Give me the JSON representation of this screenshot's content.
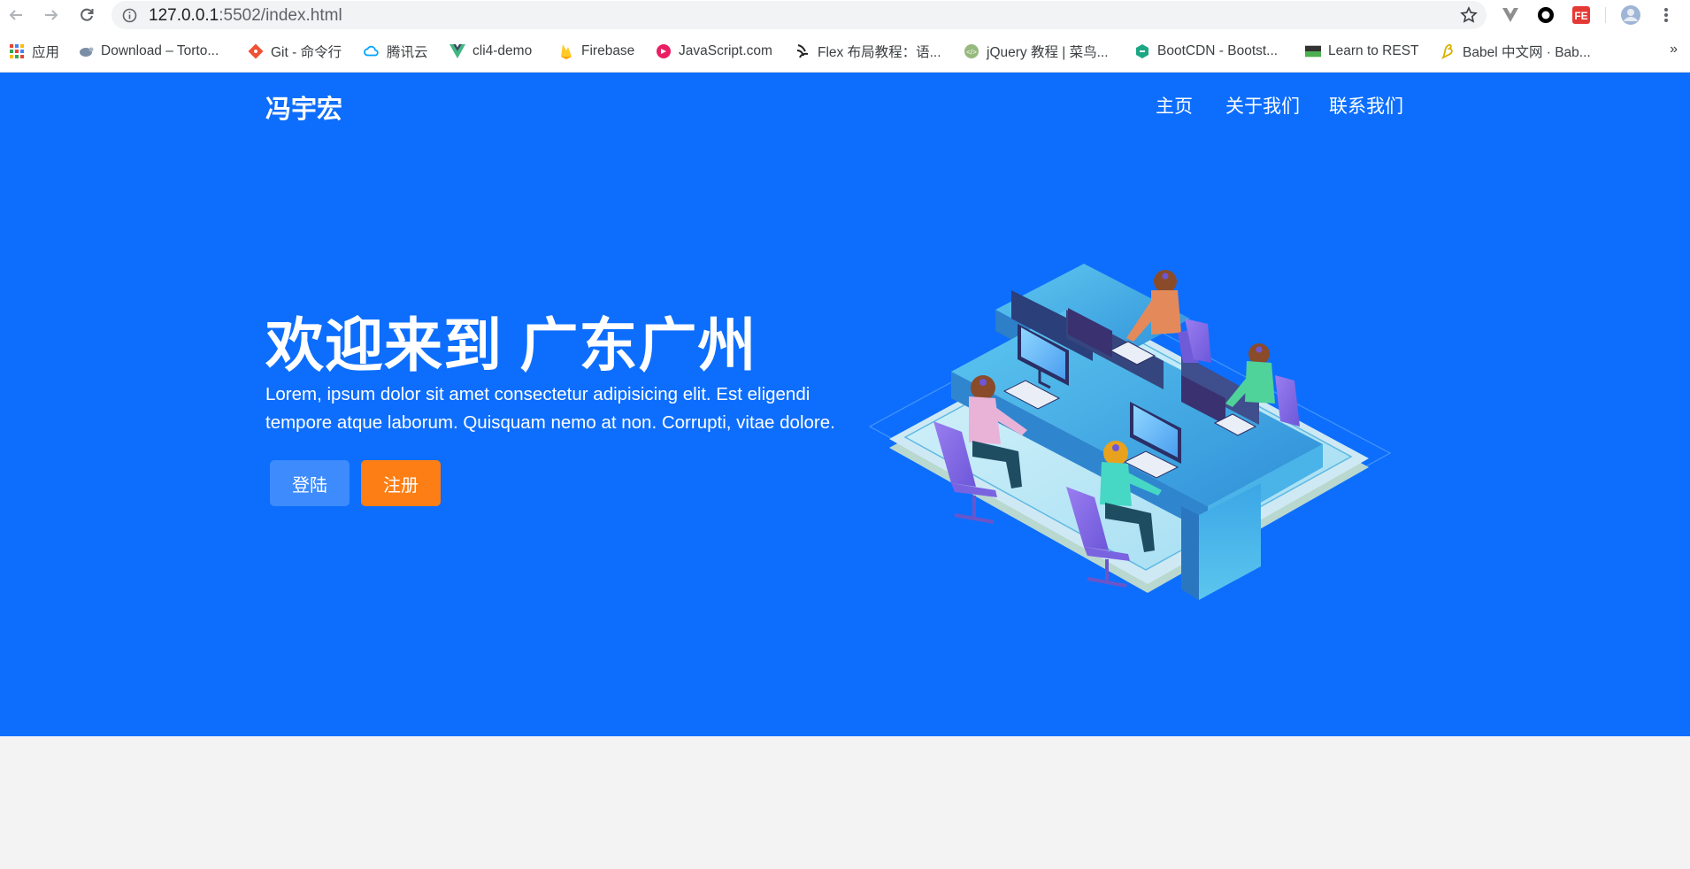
{
  "browser": {
    "url_host": "127.0.0.1",
    "url_rest": ":5502/index.html",
    "bookmarks": [
      {
        "label": "应用",
        "icon": "apps-grid-icon"
      },
      {
        "label": "Download – Torto...",
        "icon": "tortoise-icon"
      },
      {
        "label": "Git - 命令行",
        "icon": "git-icon"
      },
      {
        "label": "腾讯云",
        "icon": "cloud-icon"
      },
      {
        "label": "cli4-demo",
        "icon": "vue-icon"
      },
      {
        "label": "Firebase",
        "icon": "firebase-icon"
      },
      {
        "label": "JavaScript.com",
        "icon": "javascript-icon"
      },
      {
        "label": "Flex 布局教程：语...",
        "icon": "brush-icon"
      },
      {
        "label": "jQuery 教程 | 菜鸟...",
        "icon": "runoob-icon"
      },
      {
        "label": "BootCDN - Bootst...",
        "icon": "bootcdn-icon"
      },
      {
        "label": "Learn to REST",
        "icon": "rest-icon"
      },
      {
        "label": "Babel 中文网 · Bab...",
        "icon": "babel-icon"
      }
    ],
    "more": "»"
  },
  "page": {
    "brand": "冯宇宏",
    "nav": {
      "home": "主页",
      "about": "关于我们",
      "contact": "联系我们"
    },
    "hero": {
      "title": "欢迎来到 广东广州",
      "text": "Lorem, ipsum dolor sit amet consectetur adipisicing elit. Est eligendi tempore atque laborum. Quisquam nemo at non. Corrupti, vitae dolore.",
      "login_label": "登陆",
      "register_label": "注册"
    },
    "colors": {
      "primary": "#0d6efd",
      "login_button": "#3d8bfd",
      "register_button": "#fd7e14",
      "background": "#f3f3f3"
    }
  }
}
